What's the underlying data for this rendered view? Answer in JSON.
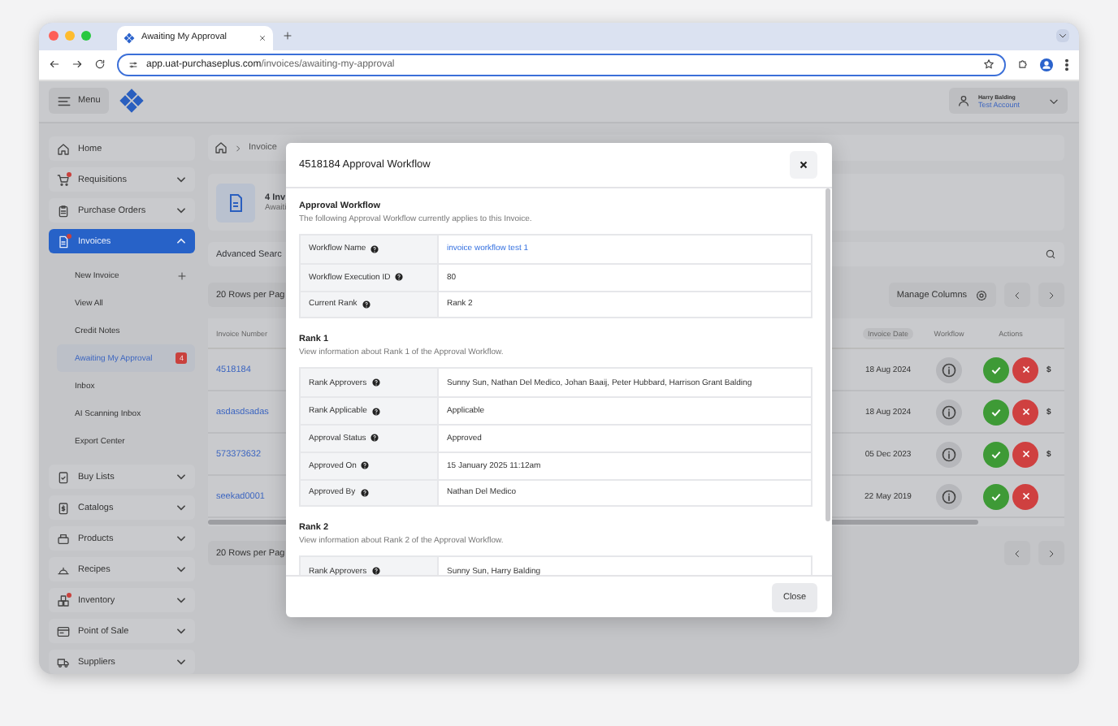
{
  "browser": {
    "tab_title": "Awaiting My Approval",
    "url_host": "app.uat-purchaseplus.com",
    "url_path": "/invoices/awaiting-my-approval"
  },
  "header": {
    "menu_label": "Menu",
    "user_name": "Harry Balding",
    "account": "Test Account"
  },
  "sidebar": {
    "items": [
      {
        "label": "Home",
        "kind": "link",
        "alert": false,
        "selected": false
      },
      {
        "label": "Requisitions",
        "kind": "group",
        "alert": true,
        "selected": false,
        "expanded": false
      },
      {
        "label": "Purchase Orders",
        "kind": "group",
        "alert": false,
        "selected": false,
        "expanded": false
      },
      {
        "label": "Invoices",
        "kind": "group",
        "alert": true,
        "selected": true,
        "expanded": true,
        "children": [
          {
            "label": "New Invoice",
            "selected": false,
            "kind": "add"
          },
          {
            "label": "View All",
            "selected": false,
            "kind": "plain"
          },
          {
            "label": "Credit Notes",
            "selected": false,
            "kind": "plain"
          },
          {
            "label": "Awaiting My Approval",
            "selected": true,
            "kind": "count",
            "count": "4"
          },
          {
            "label": "Inbox",
            "selected": false,
            "kind": "plain"
          },
          {
            "label": "AI Scanning Inbox",
            "selected": false,
            "kind": "plain"
          },
          {
            "label": "Export Center",
            "selected": false,
            "kind": "plain"
          }
        ]
      },
      {
        "label": "Buy Lists",
        "kind": "group",
        "alert": false,
        "selected": false,
        "expanded": false
      },
      {
        "label": "Catalogs",
        "kind": "group",
        "alert": false,
        "selected": false,
        "expanded": false
      },
      {
        "label": "Products",
        "kind": "group",
        "alert": false,
        "selected": false,
        "expanded": false
      },
      {
        "label": "Recipes",
        "kind": "group",
        "alert": false,
        "selected": false,
        "expanded": false
      },
      {
        "label": "Inventory",
        "kind": "group",
        "alert": true,
        "selected": false,
        "expanded": false
      },
      {
        "label": "Point of Sale",
        "kind": "group",
        "alert": false,
        "selected": false,
        "expanded": false
      },
      {
        "label": "Suppliers",
        "kind": "group",
        "alert": false,
        "selected": false,
        "expanded": false
      }
    ]
  },
  "breadcrumb": [
    "Invoice"
  ],
  "summary": {
    "title": "4 Inv",
    "subtitle": "Awaiti"
  },
  "search": {
    "label": "Advanced Searc"
  },
  "toolbar": {
    "rows_per_page": "20 Rows per Pag",
    "manage_columns": "Manage Columns"
  },
  "table": {
    "columns": [
      "Invoice Number",
      "Invoice Date",
      "Workflow",
      "Actions"
    ],
    "rows": [
      {
        "invoice_number": "4518184",
        "invoice_date": "18 Aug 2024",
        "column_6": "$"
      },
      {
        "invoice_number": "asdasdsadas",
        "invoice_date": "18 Aug 2024",
        "column_6": "$"
      },
      {
        "invoice_number": "573373632",
        "invoice_date": "05 Dec 2023",
        "column_6": "$"
      },
      {
        "invoice_number": "seekad0001",
        "invoice_date": "22 May 2019"
      }
    ]
  },
  "footer": {
    "rows_per_page": "20 Rows per Pag"
  },
  "modal": {
    "title": "4518184 Approval Workflow",
    "sections": [
      {
        "heading": "Approval Workflow",
        "description": "The following Approval Workflow currently applies to this Invoice.",
        "rows": [
          {
            "label": "Workflow Name",
            "value": "invoice workflow test 1",
            "kind": "link"
          },
          {
            "label": "Workflow Execution ID",
            "value": "80",
            "kind": "text"
          },
          {
            "label": "Current Rank",
            "value": "Rank 2",
            "kind": "text"
          }
        ]
      },
      {
        "heading": "Rank 1",
        "description": "View information about Rank 1 of the Approval Workflow.",
        "rows": [
          {
            "label": "Rank Approvers",
            "value": "Sunny Sun, Nathan Del Medico, Johan Baaij, Peter Hubbard, Harrison Grant Balding",
            "kind": "text"
          },
          {
            "label": "Rank Applicable",
            "value": "Applicable",
            "kind": "text"
          },
          {
            "label": "Approval Status",
            "value": "Approved",
            "kind": "text"
          },
          {
            "label": "Approved On",
            "value": "15 January 2025 11:12am",
            "kind": "text"
          },
          {
            "label": "Approved By",
            "value": "Nathan Del Medico",
            "kind": "text"
          }
        ]
      },
      {
        "heading": "Rank 2",
        "description": "View information about Rank 2 of the Approval Workflow.",
        "rows": [
          {
            "label": "Rank Approvers",
            "value": "Sunny Sun, Harry Balding",
            "kind": "text"
          }
        ]
      }
    ],
    "close_label": "Close"
  }
}
